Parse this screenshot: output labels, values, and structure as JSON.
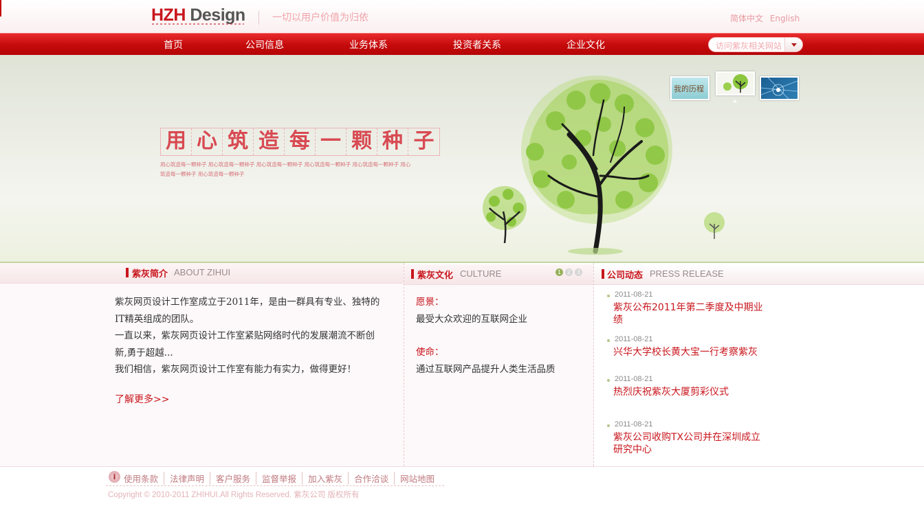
{
  "header": {
    "logo_hzh": "HZH",
    "logo_design": "Design",
    "slogan": "一切以用户价值为归依",
    "lang_cn": "简体中文",
    "lang_en": "English"
  },
  "nav": {
    "items": [
      "首页",
      "公司信息",
      "业务体系",
      "投资者关系",
      "企业文化"
    ],
    "site_select": "访问紫灰相关网站"
  },
  "banner": {
    "title_chars": [
      "用",
      "心",
      "筑",
      "造",
      "每",
      "一",
      "颗",
      "种",
      "子"
    ],
    "subtitle": "用心筑造每一颗种子 用心筑造每一颗种子 用心筑造每一颗种子 用心筑造每一颗种子 用心筑造每一颗种子 用心筑造每一颗种子 用心筑造每一颗种子",
    "thumb1_text": "我的历程"
  },
  "about": {
    "title_cn": "紫灰简介",
    "title_en": "ABOUT ZIHUI",
    "lines": [
      "紫灰网页设计工作室成立于2011年，是由一群具有专业、独特的",
      "IT精英组成的团队。",
      "一直以来，紫灰网页设计工作室紧贴网络时代的发展潮流不断创",
      "新,勇于超越...",
      "我们相信，紫灰网页设计工作室有能力有实力，做得更好！"
    ],
    "more": "了解更多>>"
  },
  "culture": {
    "title_cn": "紫灰文化",
    "title_en": "CULTURE",
    "pages": [
      "1",
      "2",
      "3"
    ],
    "vision_label": "愿景：",
    "vision": "最受大众欢迎的互联网企业",
    "mission_label": "使命：",
    "mission": "通过互联网产品提升人类生活品质"
  },
  "news": {
    "title_cn": "公司动态",
    "title_en": "PRESS RELEASE",
    "items": [
      {
        "date": "2011-08-21",
        "title": "紫灰公布2011年第二季度及中期业绩"
      },
      {
        "date": "2011-08-21",
        "title": "兴华大学校长黄大宝一行考察紫灰"
      },
      {
        "date": "2011-08-21",
        "title": "热烈庆祝紫灰大厦剪彩仪式"
      },
      {
        "date": "2011-08-21",
        "title": "紫灰公司收购TX公司并在深圳成立研究中心"
      }
    ]
  },
  "footer": {
    "icon_glyph": "i",
    "links": [
      "使用条款",
      "法律声明",
      "客户服务",
      "监督举报",
      "加入紫灰",
      "合作洽谈",
      "网站地图"
    ],
    "copyright": "Copyright © 2010-2011 ZHIHUI.All Rights Reserved.   紫灰公司 版权所有"
  },
  "colors": {
    "brand_red": "#c8161d",
    "nav_red": "#d11416",
    "leaf_green": "#8dc63f"
  }
}
